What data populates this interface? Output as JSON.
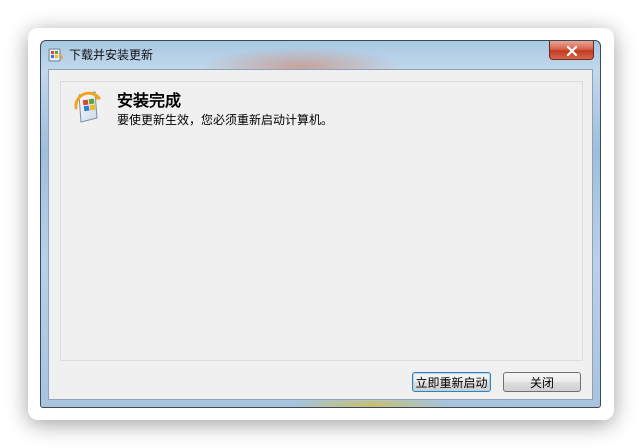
{
  "window": {
    "title": "下载并安装更新",
    "title_icon": "windows-update-icon",
    "close_icon": "close-icon"
  },
  "content": {
    "icon": "windows-update-shield-icon",
    "heading": "安装完成",
    "message": "要使更新生效，您必须重新启动计算机。"
  },
  "buttons": {
    "restart_now": "立即重新启动",
    "close": "关闭"
  },
  "colors": {
    "close_button": "#c23b22",
    "client_bg": "#f0f0f0",
    "frame": "#a9c8e2"
  }
}
